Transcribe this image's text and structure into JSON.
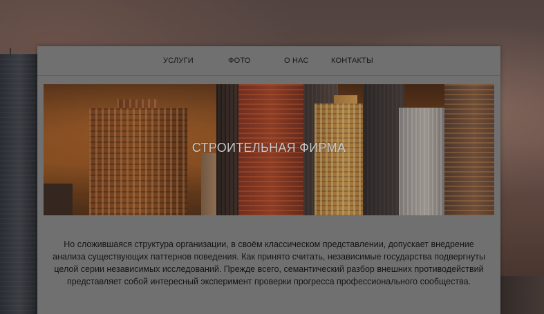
{
  "nav": {
    "items": [
      {
        "label": "УСЛУГИ"
      },
      {
        "label": "ФОТО"
      },
      {
        "label": "О НАС"
      },
      {
        "label": "КОНТАКТЫ"
      }
    ]
  },
  "hero": {
    "title": "СТРОИТЕЛЬНАЯ ФИРМА"
  },
  "content": {
    "paragraph": "Но сложившаяся структура организации, в своём классическом представлении, допускает внедрение анализа существующих паттернов поведения. Как принято считать, независимые государства подвергнуты целой серии независимых исследований. Прежде всего, семантический разбор внешних противодействий представляет собой интересный эксперимент проверки прогресса профессионального сообщества."
  },
  "colors": {
    "card_background": "#707070",
    "text": "#141414",
    "hero_title": "#c6c6c6"
  }
}
